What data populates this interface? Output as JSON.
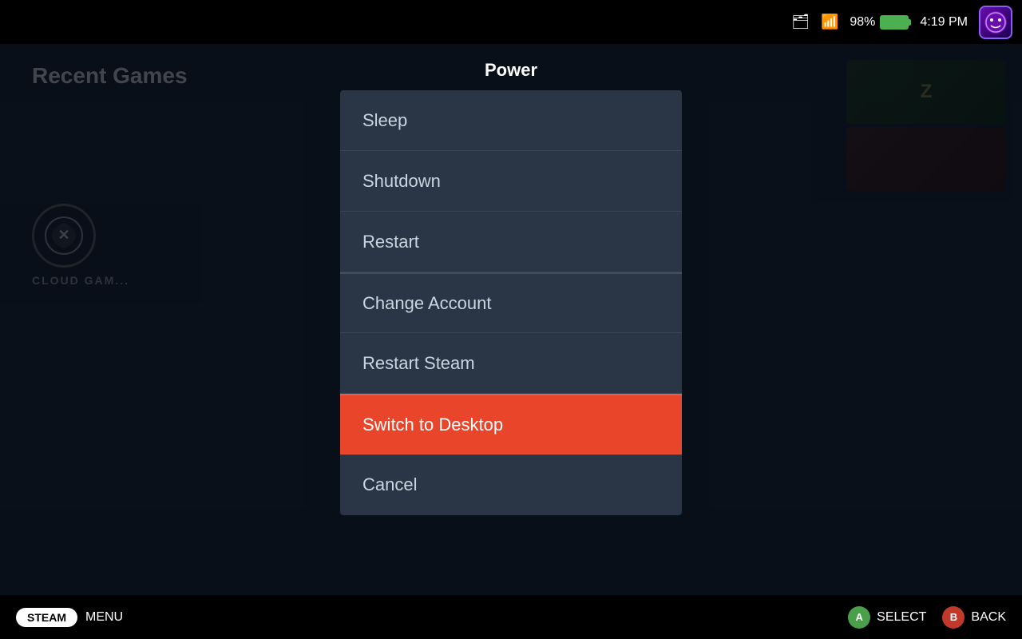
{
  "statusBar": {
    "batteryPercent": "98%",
    "time": "4:19 PM"
  },
  "background": {
    "recentGamesLabel": "Recent Games",
    "cloudGamingLabel": "CLOUD GAM..."
  },
  "powerDialog": {
    "title": "Power",
    "menuItems": [
      {
        "id": "sleep",
        "label": "Sleep",
        "active": false,
        "separatorAbove": false
      },
      {
        "id": "shutdown",
        "label": "Shutdown",
        "active": false,
        "separatorAbove": false
      },
      {
        "id": "restart",
        "label": "Restart",
        "active": false,
        "separatorAbove": false
      },
      {
        "id": "change-account",
        "label": "Change Account",
        "active": false,
        "separatorAbove": true
      },
      {
        "id": "restart-steam",
        "label": "Restart Steam",
        "active": false,
        "separatorAbove": false
      },
      {
        "id": "switch-to-desktop",
        "label": "Switch to Desktop",
        "active": true,
        "separatorAbove": true
      },
      {
        "id": "cancel",
        "label": "Cancel",
        "active": false,
        "separatorAbove": false
      }
    ]
  },
  "bottomBar": {
    "steamLabel": "STEAM",
    "menuLabel": "MENU",
    "selectLabel": "SELECT",
    "backLabel": "BACK",
    "btnA": "A",
    "btnB": "B"
  },
  "colors": {
    "activeItem": "#e8452a",
    "menuBg": "#2a3545",
    "barBg": "#000000",
    "batteryColor": "#4caf50"
  }
}
